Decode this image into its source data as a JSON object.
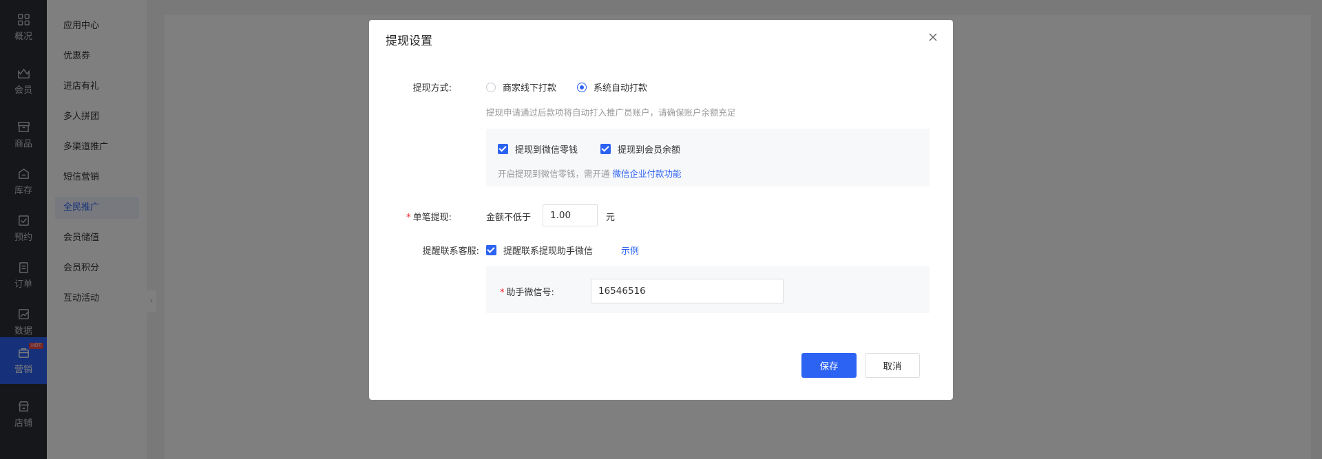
{
  "nav": {
    "items": [
      {
        "label": "概况",
        "icon": "dashboard-icon"
      },
      {
        "label": "会员",
        "icon": "member-icon"
      },
      {
        "label": "商品",
        "icon": "goods-icon"
      },
      {
        "label": "库存",
        "icon": "inventory-icon"
      },
      {
        "label": "预约",
        "icon": "appointment-icon"
      },
      {
        "label": "订单",
        "icon": "order-icon"
      },
      {
        "label": "数据",
        "icon": "data-icon"
      },
      {
        "label": "营销",
        "icon": "marketing-icon",
        "badge": "HOT",
        "active": true
      },
      {
        "label": "店铺",
        "icon": "store-icon"
      }
    ]
  },
  "subnav": {
    "items": [
      "应用中心",
      "优惠券",
      "进店有礼",
      "多人拼团",
      "多渠道推广",
      "短信营销",
      "全民推广",
      "会员储值",
      "会员积分",
      "互动活动"
    ],
    "active_index": 6
  },
  "dialog": {
    "title": "提现设置",
    "withdraw_method_label": "提现方式:",
    "option_offline": "商家线下打款",
    "option_auto": "系统自动打款",
    "selected": "系统自动打款",
    "auto_hint": "提现申请通过后款项将自动打入推广员账户，请确保账户余额充足",
    "check_wechat": "提现到微信零钱",
    "check_balance": "提现到会员余额",
    "wechat_hint": "开启提现到微信零钱，需开通",
    "wechat_hint_link": "微信企业付款功能",
    "single_withdraw_label": "单笔提现:",
    "min_amount_prefix": "金额不低于",
    "min_amount_value": "1.00",
    "min_amount_unit": "元",
    "remind_label": "提醒联系客服:",
    "remind_check": "提醒联系提现助手微信",
    "remind_example": "示例",
    "assistant_wechat_label": "助手微信号:",
    "assistant_wechat_value": "16546516",
    "save_label": "保存",
    "cancel_label": "取消"
  },
  "colors": {
    "accent": "#2d63f2",
    "nav_bg": "#2b2f36",
    "required": "#f5222d"
  }
}
